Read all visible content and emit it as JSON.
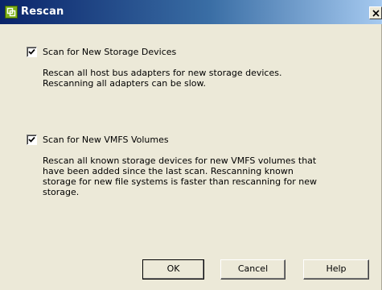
{
  "window": {
    "title": "Rescan",
    "close_glyph": "×",
    "icon": "vmware-app-icon"
  },
  "options": [
    {
      "label": "Scan for New Storage Devices",
      "checked": true,
      "description": [
        "Rescan all host bus adapters for new storage devices.",
        "Rescanning all adapters can be slow."
      ]
    },
    {
      "label": "Scan for New VMFS Volumes",
      "checked": true,
      "description": [
        "Rescan all known storage devices for new VMFS volumes that",
        "have been added since the last scan. Rescanning known",
        "storage for new file systems is faster than rescanning for new",
        "storage."
      ]
    }
  ],
  "buttons": {
    "ok": "OK",
    "cancel": "Cancel",
    "help": "Help"
  },
  "colors": {
    "title_gradient_start": "#0a246a",
    "title_gradient_end": "#a6caf0",
    "dialog_bg": "#ece9d8"
  }
}
